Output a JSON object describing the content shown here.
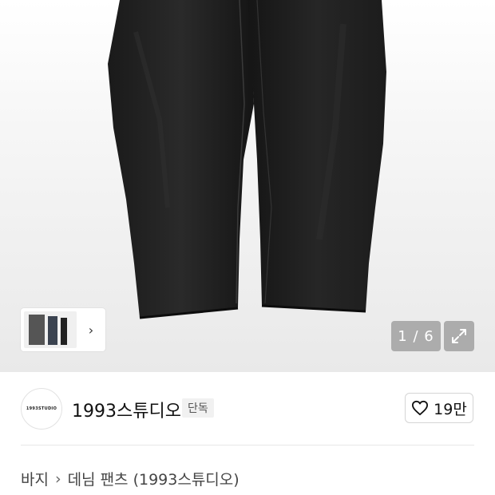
{
  "gallery": {
    "counter": "1 / 6",
    "thumb_more_icon": "chevron-right-icon",
    "expand_icon": "expand-icon"
  },
  "brand": {
    "logo_text": "1993STUDIO",
    "name": "1993스튜디오",
    "badge": "단독"
  },
  "like": {
    "icon": "heart-outline-icon",
    "count": "19만"
  },
  "breadcrumb": {
    "items": [
      "바지",
      "데님 팬츠 (1993스튜디오)"
    ],
    "separator": "›"
  }
}
